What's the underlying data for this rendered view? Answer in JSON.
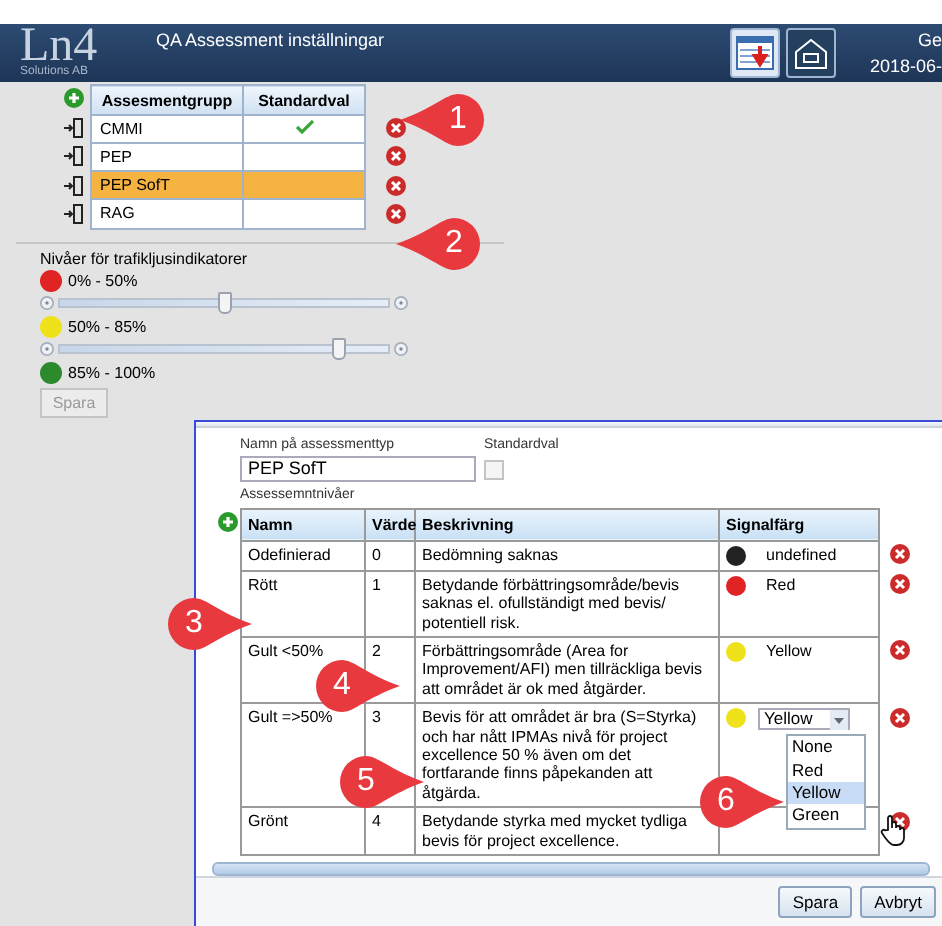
{
  "header": {
    "logo": "Ln4",
    "logo_subtitle": "Solutions AB",
    "title": "QA Assessment inställningar",
    "user_text": "Ge",
    "date_text": "2018-06-"
  },
  "groups": {
    "columns": [
      "Assesmentgrupp",
      "Standardval"
    ],
    "rows": [
      {
        "name": "CMMI",
        "default": true,
        "selected": false
      },
      {
        "name": "PEP",
        "default": false,
        "selected": false
      },
      {
        "name": "PEP SofT",
        "default": false,
        "selected": true
      },
      {
        "name": "RAG",
        "default": false,
        "selected": false
      }
    ]
  },
  "levels": {
    "title": "Nivåer för trafikljusindikatorer",
    "bands": [
      {
        "label": "0% - 50%",
        "color": "#e02424"
      },
      {
        "label": "50% - 85%",
        "color": "#f0e21a"
      },
      {
        "label": "85% - 100%",
        "color": "#2c8a2c"
      }
    ],
    "sliders": [
      {
        "level": 0.5
      },
      {
        "level": 0.85
      }
    ],
    "save_button": "Spara"
  },
  "dialog": {
    "name_label": "Namn på assessmenttyp",
    "name_value": "PEP SofT",
    "default_label": "Standardval",
    "default_checked": false,
    "levels_label": "Assessemntnivåer",
    "columns": [
      "Namn",
      "Värde",
      "Beskrivning",
      "Signalfärg"
    ],
    "rows": [
      {
        "name": "Odefinierad",
        "value": "0",
        "description": "Bedömning saknas",
        "signal": {
          "label": "undefined",
          "color": "#222222"
        }
      },
      {
        "name": "Rött",
        "value": "1",
        "description": "Betydande förbättringsområde/bevis saknas el. ofullständigt med bevis/ potentiell risk.",
        "signal": {
          "label": "Red",
          "color": "#e02424"
        }
      },
      {
        "name": "Gult <50%",
        "value": "2",
        "description": "Förbättringsområde (Area for Improvement/AFI) men tillräckliga bevis att området är ok med åtgärder.",
        "signal": {
          "label": "Yellow",
          "color": "#f0e21a"
        }
      },
      {
        "name": "Gult =>50%",
        "value": "3",
        "description": "Bevis för att området är bra (S=Styrka) och har nått IPMAs nivå för project excellence 50 % även om det fortfarande finns påpekanden att åtgärda.",
        "signal": {
          "label": "Yellow",
          "color": "#f0e21a"
        },
        "dropdown": {
          "open": true,
          "options": [
            {
              "label": "None",
              "selected": false
            },
            {
              "label": "Red",
              "selected": false
            },
            {
              "label": "Yellow",
              "selected": true
            },
            {
              "label": "Green",
              "selected": false
            }
          ]
        }
      },
      {
        "name": "Grönt",
        "value": "4",
        "description": "Betydande styrka med mycket tydliga bevis för project excellence."
      }
    ],
    "buttons": [
      "Spara",
      "Avbryt"
    ]
  },
  "callouts": [
    "1",
    "2",
    "3",
    "4",
    "5",
    "6"
  ]
}
